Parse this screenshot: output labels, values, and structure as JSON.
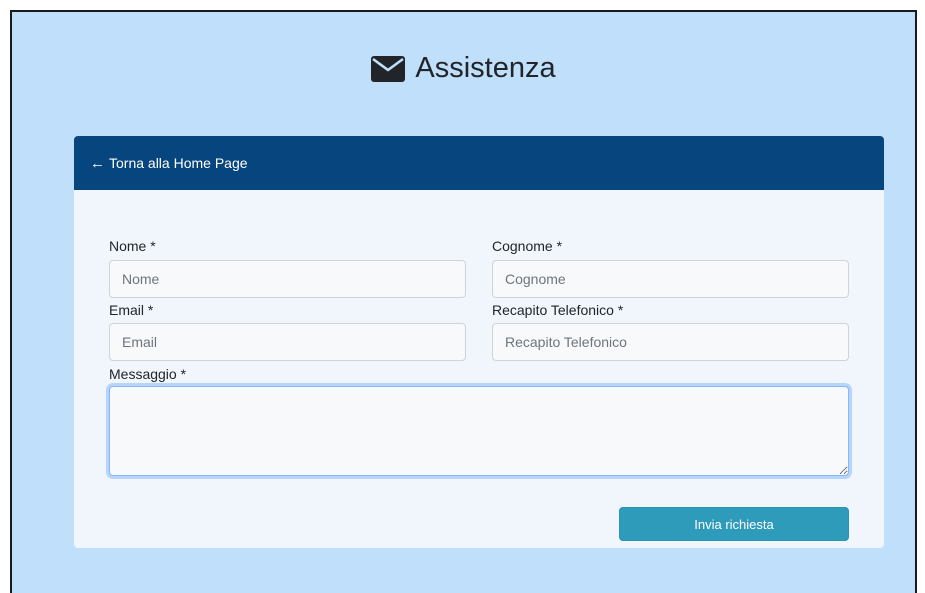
{
  "header": {
    "title": "Assistenza",
    "icon": "envelope-icon"
  },
  "card": {
    "back_link": "Torna alla Home Page",
    "back_icon": "arrow-left-icon",
    "header_color": "#06457e"
  },
  "form": {
    "nome": {
      "label": "Nome *",
      "placeholder": "Nome",
      "value": ""
    },
    "cognome": {
      "label": "Cognome *",
      "placeholder": "Cognome",
      "value": ""
    },
    "email": {
      "label": "Email *",
      "placeholder": "Email",
      "value": ""
    },
    "telefono": {
      "label": "Recapito Telefonico *",
      "placeholder": "Recapito Telefonico",
      "value": ""
    },
    "messaggio": {
      "label": "Messaggio *",
      "value": ""
    },
    "submit_label": "Invia richiesta"
  },
  "colors": {
    "background": "#bfdffb",
    "card_background": "#f1f6fd",
    "button": "#2e9bbb"
  }
}
